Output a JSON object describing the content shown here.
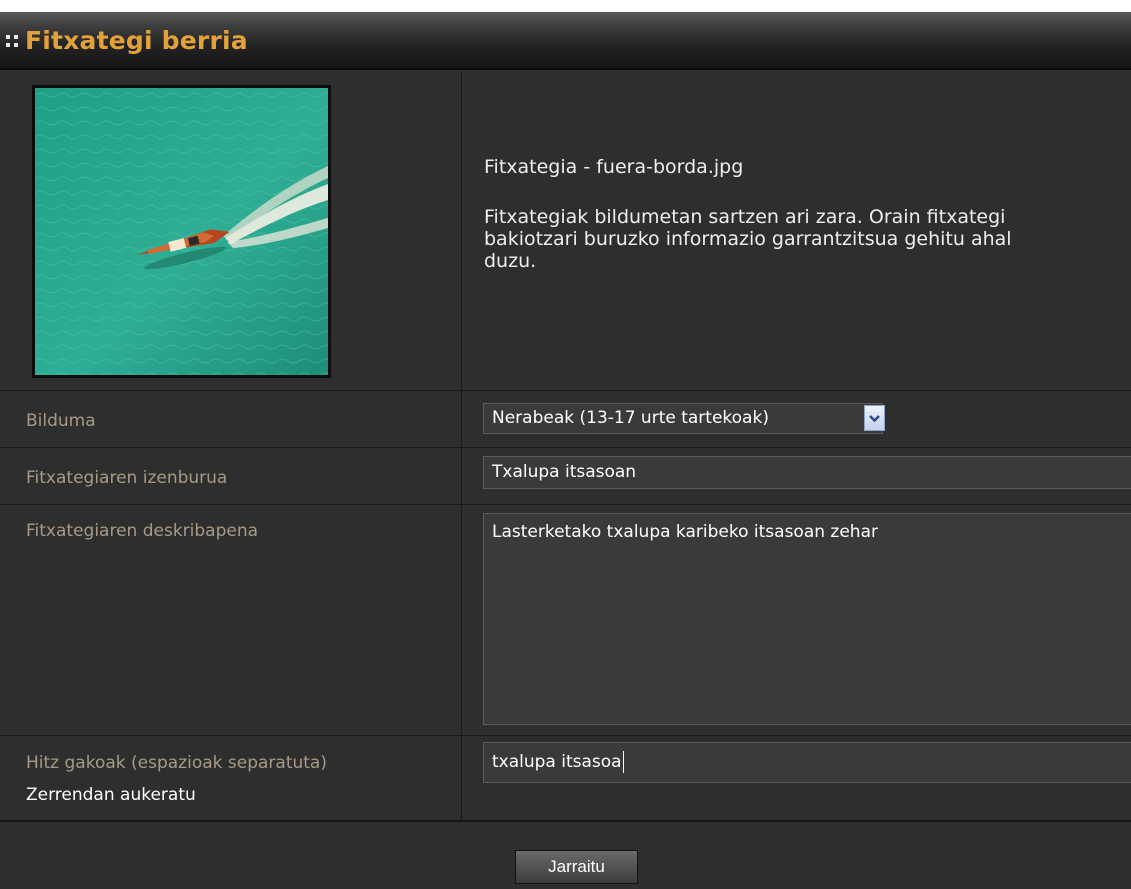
{
  "header": {
    "title": "Fitxategi berria",
    "grip_icon": "drag-grip-icon"
  },
  "file_info": {
    "filename_line": "Fitxategia - fuera-borda.jpg",
    "instructions": "Fitxategiak bildumetan sartzen ari zara. Orain fitxategi bakiotzari buruzko informazio garrantzitsua gehitu ahal duzu.",
    "preview_image": "speedboat-on-turquoise-sea"
  },
  "form": {
    "collection": {
      "label": "Bilduma",
      "selected": "Nerabeak (13-17 urte tartekoak)",
      "dropdown_icon": "chevron-down-icon"
    },
    "title": {
      "label": "Fitxategiaren izenburua",
      "value": "Txalupa itsasoan"
    },
    "description": {
      "label": "Fitxategiaren deskribapena",
      "value": "Lasterketako txalupa karibeko itsasoan zehar"
    },
    "keywords": {
      "label": "Hitz gakoak (espazioak separatuta)",
      "list_link": "Zerrendan aukeratu",
      "value": "txalupa itsasoa"
    }
  },
  "footer": {
    "continue_label": "Jarraitu"
  },
  "colors": {
    "header_title": "#e2a13a",
    "panel_bg": "#2e2e2e",
    "field_bg": "#3a3a3a",
    "label_text": "#a89a86"
  }
}
